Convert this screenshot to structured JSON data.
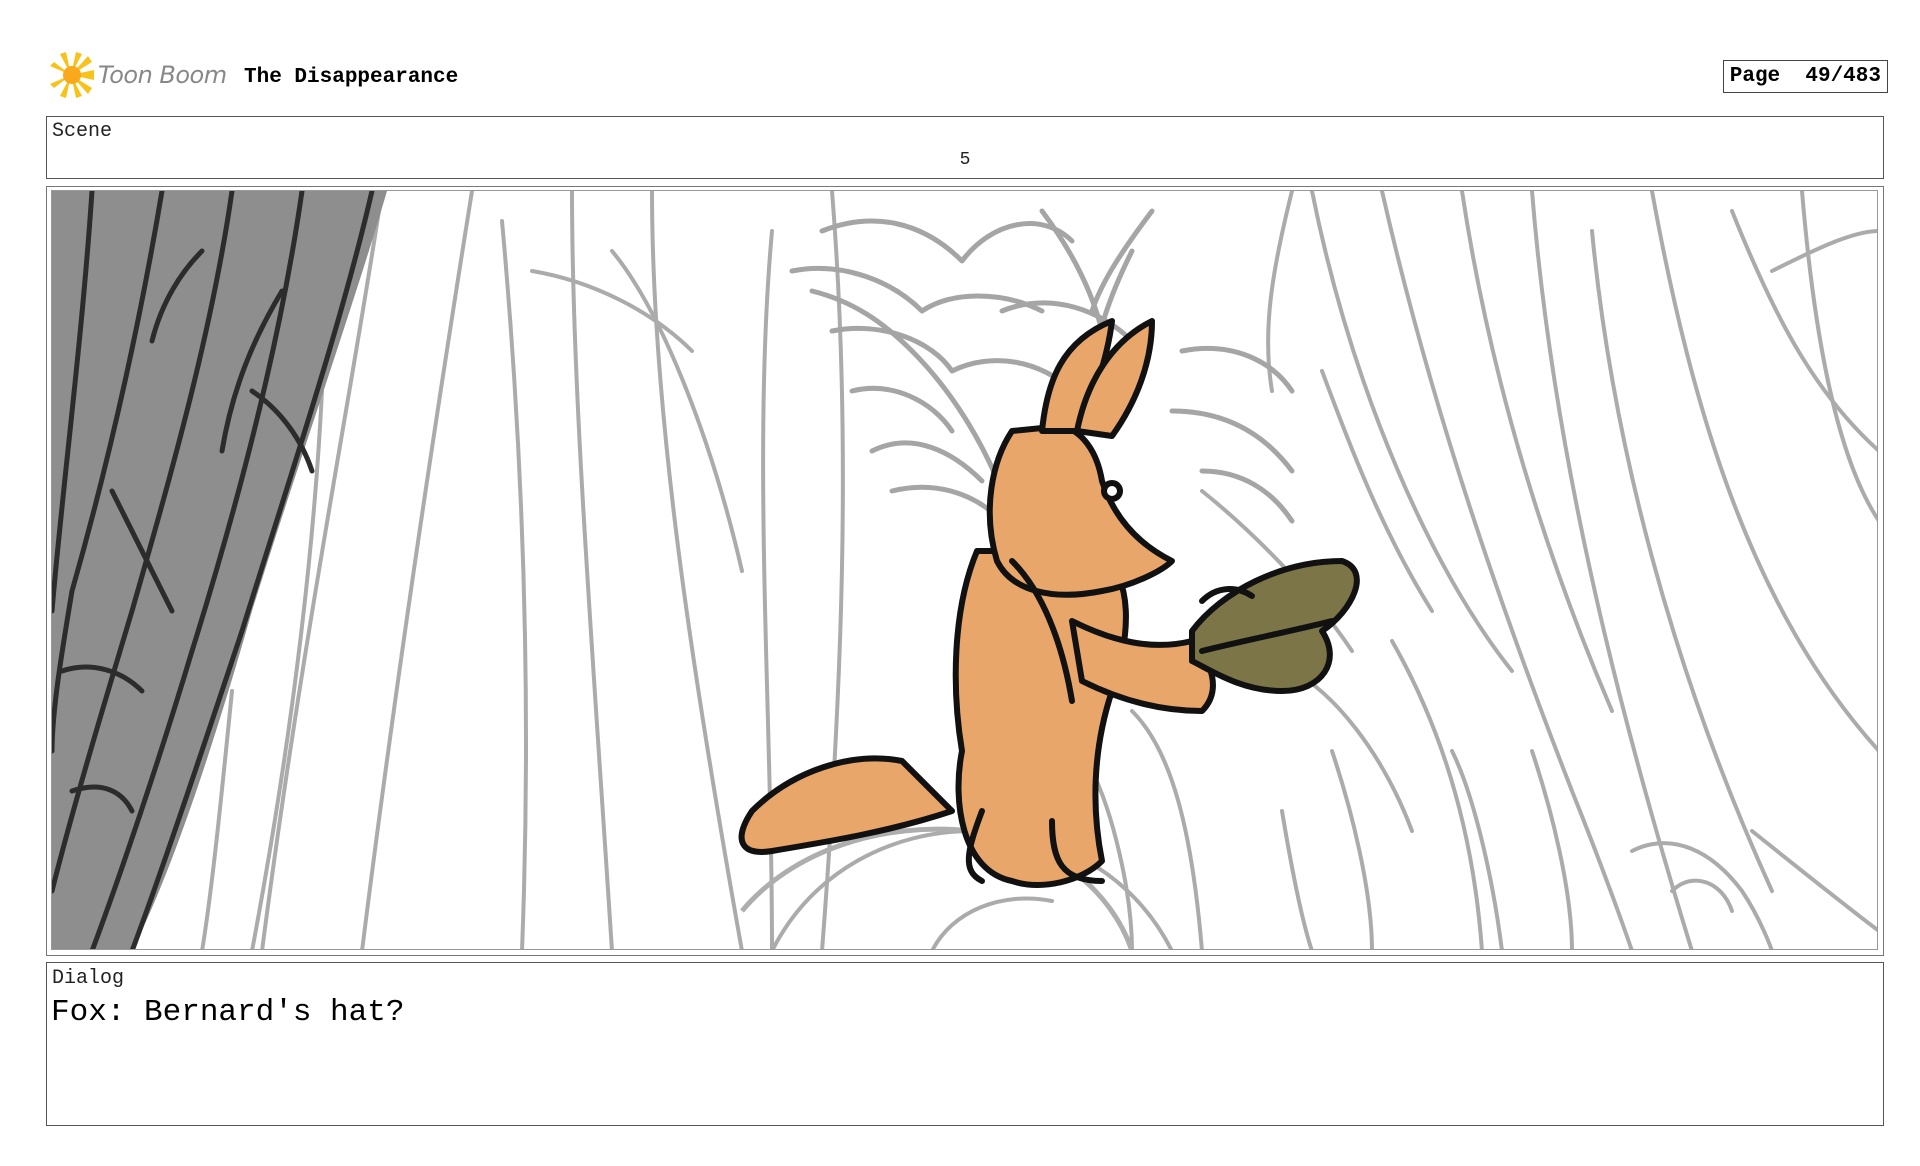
{
  "header": {
    "logo_text": "Toon Boom",
    "project_title": "The Disappearance",
    "page_label": "Page",
    "page_value": "49/483"
  },
  "scene": {
    "label": "Scene",
    "number": "5"
  },
  "panel": {
    "image_icon": "storyboard-drawing-fox-with-hat",
    "colors": {
      "fox": "#E8A66A",
      "hat": "#7C7548",
      "tree_shadow": "#8E8E8E",
      "sketch_lines": "#AAAAAA"
    }
  },
  "dialog": {
    "label": "Dialog",
    "text": "Fox: Bernard's hat?"
  }
}
